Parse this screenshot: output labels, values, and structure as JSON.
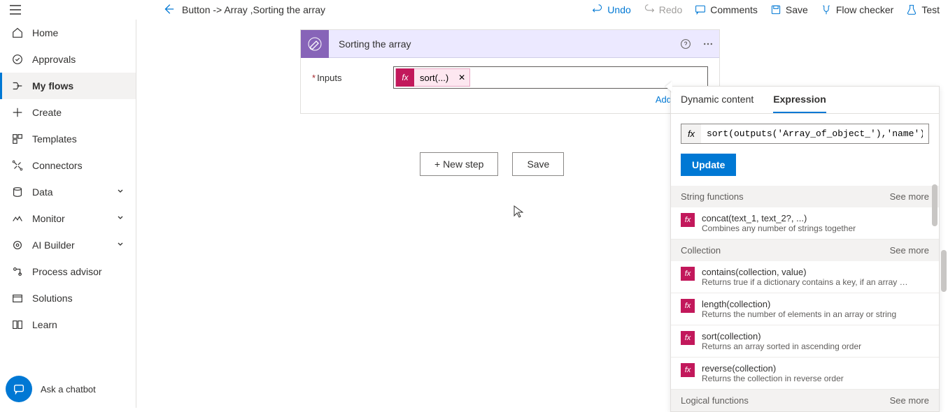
{
  "breadcrumb": "Button -> Array ,Sorting the array",
  "topbar": {
    "undo": "Undo",
    "redo": "Redo",
    "comments": "Comments",
    "save": "Save",
    "flow_checker": "Flow checker",
    "test": "Test"
  },
  "sidebar": {
    "items": [
      {
        "label": "Home"
      },
      {
        "label": "Approvals"
      },
      {
        "label": "My flows"
      },
      {
        "label": "Create"
      },
      {
        "label": "Templates"
      },
      {
        "label": "Connectors"
      },
      {
        "label": "Data"
      },
      {
        "label": "Monitor"
      },
      {
        "label": "AI Builder"
      },
      {
        "label": "Process advisor"
      },
      {
        "label": "Solutions"
      },
      {
        "label": "Learn"
      }
    ],
    "chatbot": "Ask a chatbot"
  },
  "step": {
    "title": "Sorting the array",
    "field_label": "Inputs",
    "token": "sort(...)",
    "add_dynamic": "Add dynamic"
  },
  "actions": {
    "new_step": "+ New step",
    "save": "Save"
  },
  "expression_panel": {
    "tab_dynamic": "Dynamic content",
    "tab_expression": "Expression",
    "value": "sort(outputs('Array_of_object_'),'name')",
    "update": "Update",
    "see_more": "See more",
    "sections": {
      "string": "String functions",
      "collection": "Collection",
      "logical": "Logical functions"
    },
    "funcs": {
      "concat": {
        "sig": "concat(text_1, text_2?, ...)",
        "desc": "Combines any number of strings together"
      },
      "contains": {
        "sig": "contains(collection, value)",
        "desc": "Returns true if a dictionary contains a key, if an array cont..."
      },
      "length": {
        "sig": "length(collection)",
        "desc": "Returns the number of elements in an array or string"
      },
      "sort": {
        "sig": "sort(collection)",
        "desc": "Returns an array sorted in ascending order"
      },
      "reverse": {
        "sig": "reverse(collection)",
        "desc": "Returns the collection in reverse order"
      }
    }
  }
}
